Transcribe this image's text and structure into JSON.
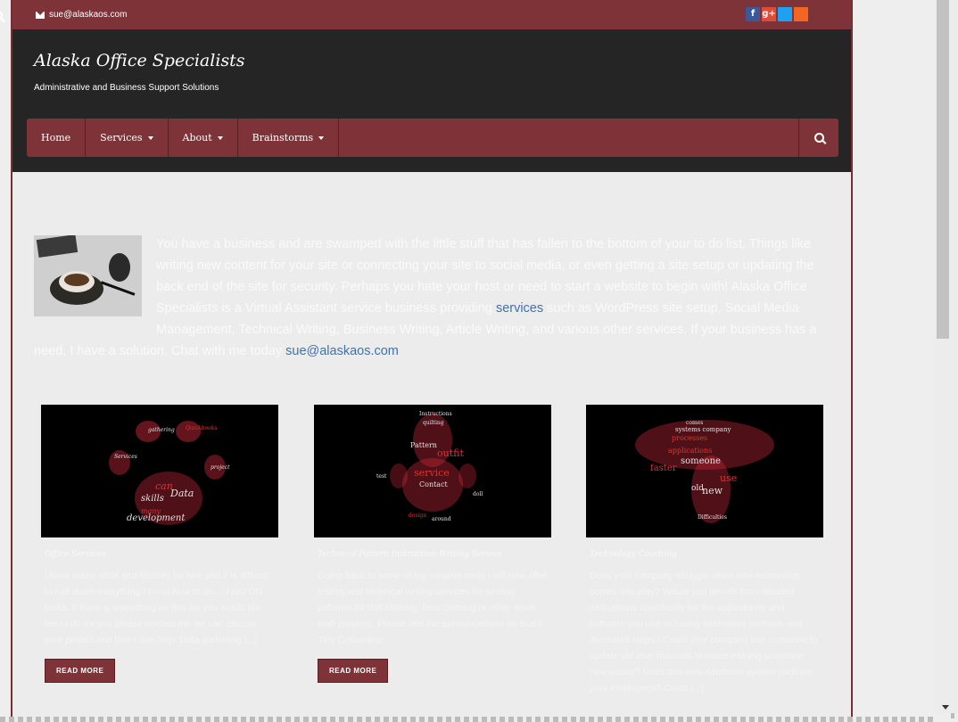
{
  "topbar": {
    "email": "sue@alaskaos.com",
    "social": [
      "f",
      "g+",
      "t",
      "rss"
    ]
  },
  "header": {
    "title": "Alaska Office Specialists",
    "tagline": "Administrative and Business Support Solutions"
  },
  "nav": {
    "items": [
      {
        "label": "Home"
      },
      {
        "label": "Services"
      },
      {
        "label": "About"
      },
      {
        "label": "Brainstorms"
      }
    ]
  },
  "intro": {
    "text_1": "You have a business and are swamped with the little stuff that has fallen to the bottom of your to do list. Things like writing new content for your site or connecting your site to social media, or even getting a site setup or updating the back end of the site for security. Perhaps you hate your host or need to start a website to begin with! Alaska Office Specialists is a Virtual Assistant service business providing ",
    "link_services": "services",
    "text_2": " such as WordPress site setup, Social Media Management, Technical Writing, Business Writing, Article Writing, and various other services. If your business has a need, I have a solution. Chat with me today ",
    "link_email": "sue@alaskaos.com"
  },
  "cards": [
    {
      "title": "Office Services",
      "text": "I have many skills and abilities for hire and it is difficult to nail down everything I know how to do.... I just DO tasks. If there is something on this list you would like me to do for you please contact me we can discuss your project and how I can help. Data gathering [...]",
      "button": "READ MORE"
    },
    {
      "title": "Technical Pattern Instruction Writing Service",
      "text": "Going back to some of my creative roots I will now offer testing and technical writing services for sewing patterns for doll clothing, bear clothing or other sewn craft patterns. Please see the announcement on Sue's Tiny Costumes!",
      "button": "READ MORE"
    },
    {
      "title": "Technology Coaching",
      "text": "Does your company struggle when new technology comes into play? Would you benefit from detailed instructions specifically for the applications and software you use including alternative methods and illustrated steps? Could your company use someone to update old user manuals to make training someone new easier? Does that new database system confuse your employees? Could [...]",
      "button": ""
    }
  ],
  "colors": {
    "brand": "#7e3338",
    "header_bg": "#252525",
    "link": "#3d73ad"
  }
}
